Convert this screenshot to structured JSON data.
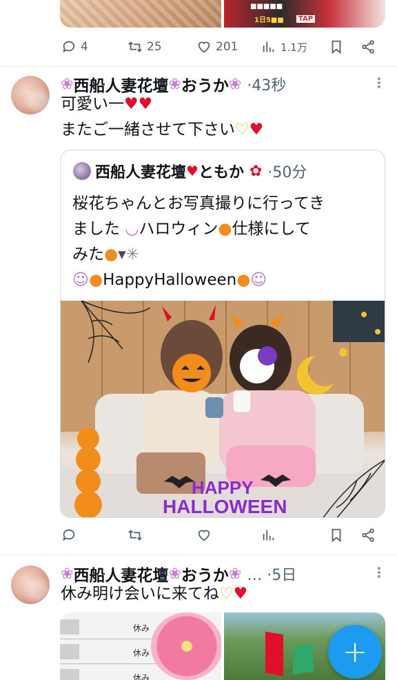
{
  "prev_tweet": {
    "reply_count": "4",
    "retweet_count": "25",
    "like_count": "201",
    "view_count": "1.1万"
  },
  "tweet1": {
    "name_part1": "西船人妻花壇",
    "name_part2": "おうか",
    "time": "·43秒",
    "line1": "可愛い一",
    "line2": "またご一緒させて下さい"
  },
  "quote": {
    "name": "西船人妻花壇",
    "name2": "ともか",
    "time": "·50分",
    "line1": "桜花ちゃんとお写真撮りに行ってき",
    "line2a": "ました",
    "line2b": "ハロウィン",
    "line2c": "仕様にして",
    "line3": "みた",
    "line4": "HappyHalloween",
    "overlay_text1": "HAPPY",
    "overlay_text2": "HALLOWEEN"
  },
  "tweet2": {
    "name_part1": "西船人妻花壇",
    "name_part2": "おうか",
    "time": "… ·5日",
    "line1": "休み明け会いに来てね",
    "label": "休み"
  },
  "fab_label": "+",
  "colors": {
    "accent": "#1d9bf0",
    "heart": "#e0102c",
    "muted": "#536471",
    "flower": "#c77dd6"
  }
}
